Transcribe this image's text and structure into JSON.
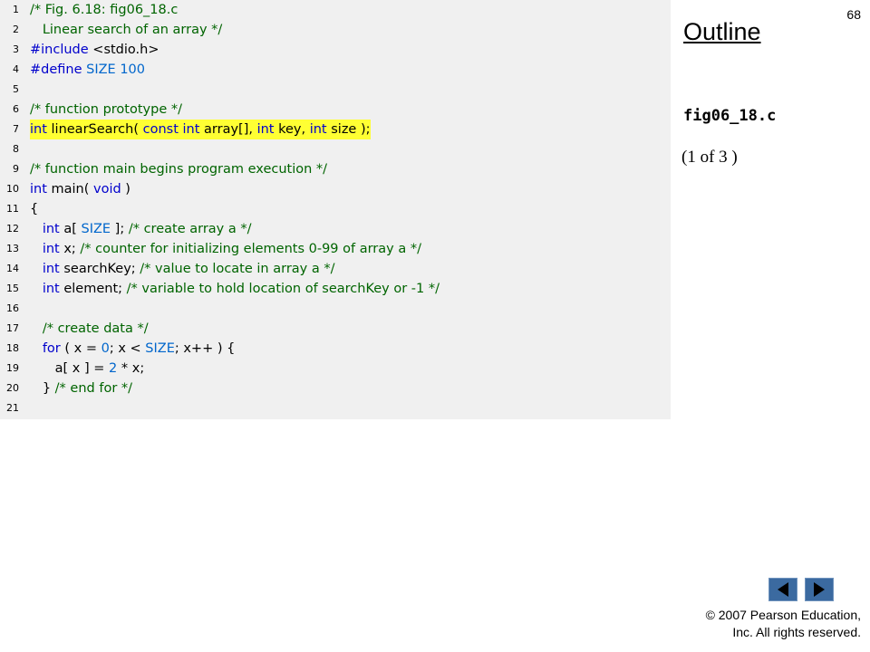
{
  "slide": {
    "page_number": "68",
    "outline_title": "Outline",
    "file_name": "fig06_18.c",
    "part_of": "(1 of 3 )",
    "copyright_line1": "© 2007 Pearson Education,",
    "copyright_line2": "Inc.  All rights reserved."
  },
  "code": {
    "highlighted_line": 7,
    "lines": [
      {
        "num": "1",
        "tokens": [
          {
            "t": "cm",
            "s": "/* Fig. 6.18: fig06_18.c"
          }
        ]
      },
      {
        "num": "2",
        "tokens": [
          {
            "t": "cm",
            "s": "   Linear search of an array */"
          }
        ]
      },
      {
        "num": "3",
        "tokens": [
          {
            "t": "kw",
            "s": "#include"
          },
          {
            "t": "plain",
            "s": " <stdio.h>"
          }
        ]
      },
      {
        "num": "4",
        "tokens": [
          {
            "t": "kw",
            "s": "#define"
          },
          {
            "t": "plain",
            "s": " "
          },
          {
            "t": "mac",
            "s": "SIZE 100"
          }
        ]
      },
      {
        "num": "5",
        "tokens": []
      },
      {
        "num": "6",
        "tokens": [
          {
            "t": "cm",
            "s": "/* function prototype */"
          }
        ]
      },
      {
        "num": "7",
        "tokens": [
          {
            "t": "kw",
            "s": "int"
          },
          {
            "t": "plain",
            "s": " linearSearch( "
          },
          {
            "t": "kw",
            "s": "const int"
          },
          {
            "t": "plain",
            "s": " array[], "
          },
          {
            "t": "kw",
            "s": "int"
          },
          {
            "t": "plain",
            "s": " key, "
          },
          {
            "t": "kw",
            "s": "int"
          },
          {
            "t": "plain",
            "s": " size );"
          }
        ]
      },
      {
        "num": "8",
        "tokens": []
      },
      {
        "num": "9",
        "tokens": [
          {
            "t": "cm",
            "s": "/* function main begins program execution */"
          }
        ]
      },
      {
        "num": "10",
        "tokens": [
          {
            "t": "kw",
            "s": "int"
          },
          {
            "t": "plain",
            "s": " main( "
          },
          {
            "t": "kw",
            "s": "void"
          },
          {
            "t": "plain",
            "s": " )"
          }
        ]
      },
      {
        "num": "11",
        "tokens": [
          {
            "t": "plain",
            "s": "{"
          }
        ]
      },
      {
        "num": "12",
        "tokens": [
          {
            "t": "plain",
            "s": "   "
          },
          {
            "t": "kw",
            "s": "int"
          },
          {
            "t": "plain",
            "s": " a[ "
          },
          {
            "t": "mac",
            "s": "SIZE"
          },
          {
            "t": "plain",
            "s": " ]; "
          },
          {
            "t": "cm",
            "s": "/* create array a */"
          }
        ]
      },
      {
        "num": "13",
        "tokens": [
          {
            "t": "plain",
            "s": "   "
          },
          {
            "t": "kw",
            "s": "int"
          },
          {
            "t": "plain",
            "s": " x; "
          },
          {
            "t": "cm",
            "s": "/* counter for initializing elements 0-99 of array a */"
          }
        ]
      },
      {
        "num": "14",
        "tokens": [
          {
            "t": "plain",
            "s": "   "
          },
          {
            "t": "kw",
            "s": "int"
          },
          {
            "t": "plain",
            "s": " searchKey; "
          },
          {
            "t": "cm",
            "s": "/* value to locate in array a */"
          }
        ]
      },
      {
        "num": "15",
        "tokens": [
          {
            "t": "plain",
            "s": "   "
          },
          {
            "t": "kw",
            "s": "int"
          },
          {
            "t": "plain",
            "s": " element; "
          },
          {
            "t": "cm",
            "s": "/* variable to hold location of searchKey or -1 */"
          }
        ]
      },
      {
        "num": "16",
        "tokens": []
      },
      {
        "num": "17",
        "tokens": [
          {
            "t": "plain",
            "s": "   "
          },
          {
            "t": "cm",
            "s": "/* create data */"
          }
        ]
      },
      {
        "num": "18",
        "tokens": [
          {
            "t": "plain",
            "s": "   "
          },
          {
            "t": "kw",
            "s": "for"
          },
          {
            "t": "plain",
            "s": " ( x = "
          },
          {
            "t": "mac",
            "s": "0"
          },
          {
            "t": "plain",
            "s": "; x < "
          },
          {
            "t": "mac",
            "s": "SIZE"
          },
          {
            "t": "plain",
            "s": "; x++ ) {"
          }
        ]
      },
      {
        "num": "19",
        "tokens": [
          {
            "t": "plain",
            "s": "      a[ x ] = "
          },
          {
            "t": "mac",
            "s": "2"
          },
          {
            "t": "plain",
            "s": " * x;"
          }
        ]
      },
      {
        "num": "20",
        "tokens": [
          {
            "t": "plain",
            "s": "   } "
          },
          {
            "t": "cm",
            "s": "/* end for */"
          }
        ]
      },
      {
        "num": "21",
        "tokens": []
      }
    ]
  },
  "nav": {
    "prev_icon": "triangle-left-icon",
    "next_icon": "triangle-right-icon"
  },
  "colors": {
    "keyword": "#0000cc",
    "comment": "#006400",
    "macro": "#0066cc",
    "highlight": "#ffff33",
    "code_bg": "#f0f0f0",
    "nav_button": "#3b6aa0"
  }
}
